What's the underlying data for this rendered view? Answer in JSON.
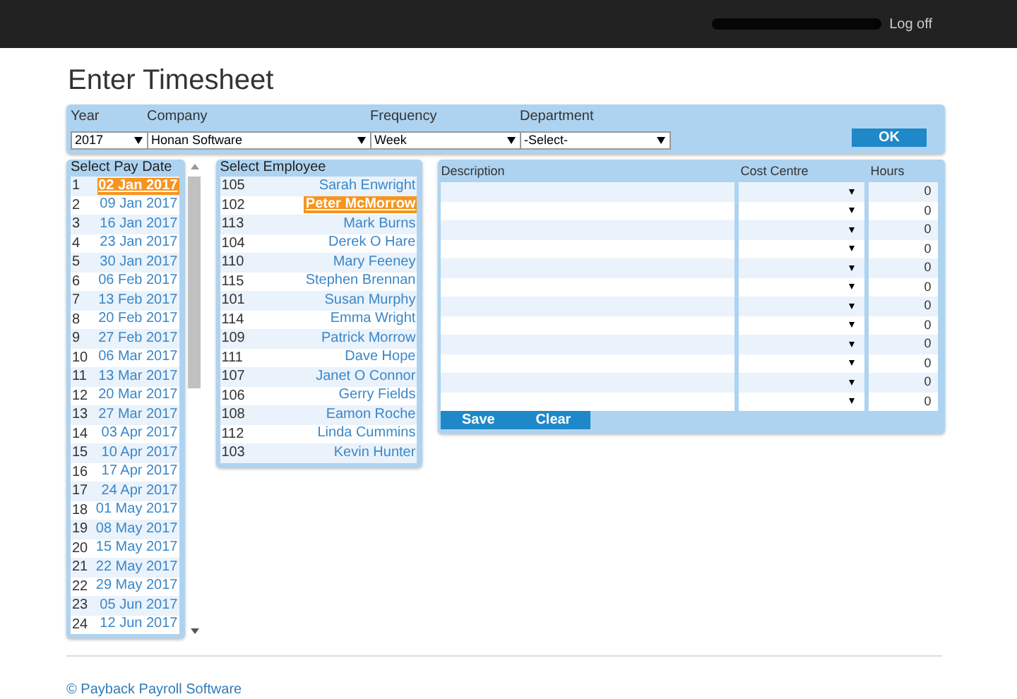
{
  "header": {
    "logoff": "Log off"
  },
  "title": "Enter Timesheet",
  "filters": [
    {
      "label": "Year",
      "value": "2017",
      "kind": "year"
    },
    {
      "label": "Company",
      "value": "Honan Software",
      "kind": "company"
    },
    {
      "label": "Frequency",
      "value": "Week",
      "kind": "frequency"
    },
    {
      "label": "Department",
      "value": "-Select-",
      "kind": "department"
    }
  ],
  "ok_button": "OK",
  "pay_dates": {
    "title": "Select Pay Date",
    "items": [
      {
        "num": "1",
        "date": "02 Jan 2017",
        "selected": true
      },
      {
        "num": "2",
        "date": "09 Jan 2017",
        "selected": false
      },
      {
        "num": "3",
        "date": "16 Jan 2017",
        "selected": false
      },
      {
        "num": "4",
        "date": "23 Jan 2017",
        "selected": false
      },
      {
        "num": "5",
        "date": "30 Jan 2017",
        "selected": false
      },
      {
        "num": "6",
        "date": "06 Feb 2017",
        "selected": false
      },
      {
        "num": "7",
        "date": "13 Feb 2017",
        "selected": false
      },
      {
        "num": "8",
        "date": "20 Feb 2017",
        "selected": false
      },
      {
        "num": "9",
        "date": "27 Feb 2017",
        "selected": false
      },
      {
        "num": "10",
        "date": "06 Mar 2017",
        "selected": false
      },
      {
        "num": "11",
        "date": "13 Mar 2017",
        "selected": false
      },
      {
        "num": "12",
        "date": "20 Mar 2017",
        "selected": false
      },
      {
        "num": "13",
        "date": "27 Mar 2017",
        "selected": false
      },
      {
        "num": "14",
        "date": "03 Apr 2017",
        "selected": false
      },
      {
        "num": "15",
        "date": "10 Apr 2017",
        "selected": false
      },
      {
        "num": "16",
        "date": "17 Apr 2017",
        "selected": false
      },
      {
        "num": "17",
        "date": "24 Apr 2017",
        "selected": false
      },
      {
        "num": "18",
        "date": "01 May 2017",
        "selected": false
      },
      {
        "num": "19",
        "date": "08 May 2017",
        "selected": false
      },
      {
        "num": "20",
        "date": "15 May 2017",
        "selected": false
      },
      {
        "num": "21",
        "date": "22 May 2017",
        "selected": false
      },
      {
        "num": "22",
        "date": "29 May 2017",
        "selected": false
      },
      {
        "num": "23",
        "date": "05 Jun 2017",
        "selected": false
      },
      {
        "num": "24",
        "date": "12 Jun 2017",
        "selected": false
      }
    ]
  },
  "employees": {
    "title": "Select Employee",
    "items": [
      {
        "id": "105",
        "name": "Sarah Enwright",
        "selected": false
      },
      {
        "id": "102",
        "name": "Peter McMorrow",
        "selected": true
      },
      {
        "id": "113",
        "name": "Mark Burns",
        "selected": false
      },
      {
        "id": "104",
        "name": "Derek O Hare",
        "selected": false
      },
      {
        "id": "110",
        "name": "Mary Feeney",
        "selected": false
      },
      {
        "id": "115",
        "name": "Stephen Brennan",
        "selected": false
      },
      {
        "id": "101",
        "name": "Susan Murphy",
        "selected": false
      },
      {
        "id": "114",
        "name": "Emma Wright",
        "selected": false
      },
      {
        "id": "109",
        "name": "Patrick Morrow",
        "selected": false
      },
      {
        "id": "111",
        "name": "Dave Hope",
        "selected": false
      },
      {
        "id": "107",
        "name": "Janet O Connor",
        "selected": false
      },
      {
        "id": "106",
        "name": "Gerry Fields",
        "selected": false
      },
      {
        "id": "108",
        "name": "Eamon Roche",
        "selected": false
      },
      {
        "id": "112",
        "name": "Linda Cummins",
        "selected": false
      },
      {
        "id": "103",
        "name": "Kevin Hunter",
        "selected": false
      }
    ]
  },
  "timesheet": {
    "columns": [
      "Description",
      "Cost Centre",
      "Hours"
    ],
    "rows": [
      {
        "hours": "0"
      },
      {
        "hours": "0"
      },
      {
        "hours": "0"
      },
      {
        "hours": "0"
      },
      {
        "hours": "0"
      },
      {
        "hours": "0"
      },
      {
        "hours": "0"
      },
      {
        "hours": "0"
      },
      {
        "hours": "0"
      },
      {
        "hours": "0"
      },
      {
        "hours": "0"
      },
      {
        "hours": "0"
      }
    ],
    "buttons": [
      "Save",
      "Clear"
    ]
  },
  "footer": "© Payback Payroll Software"
}
